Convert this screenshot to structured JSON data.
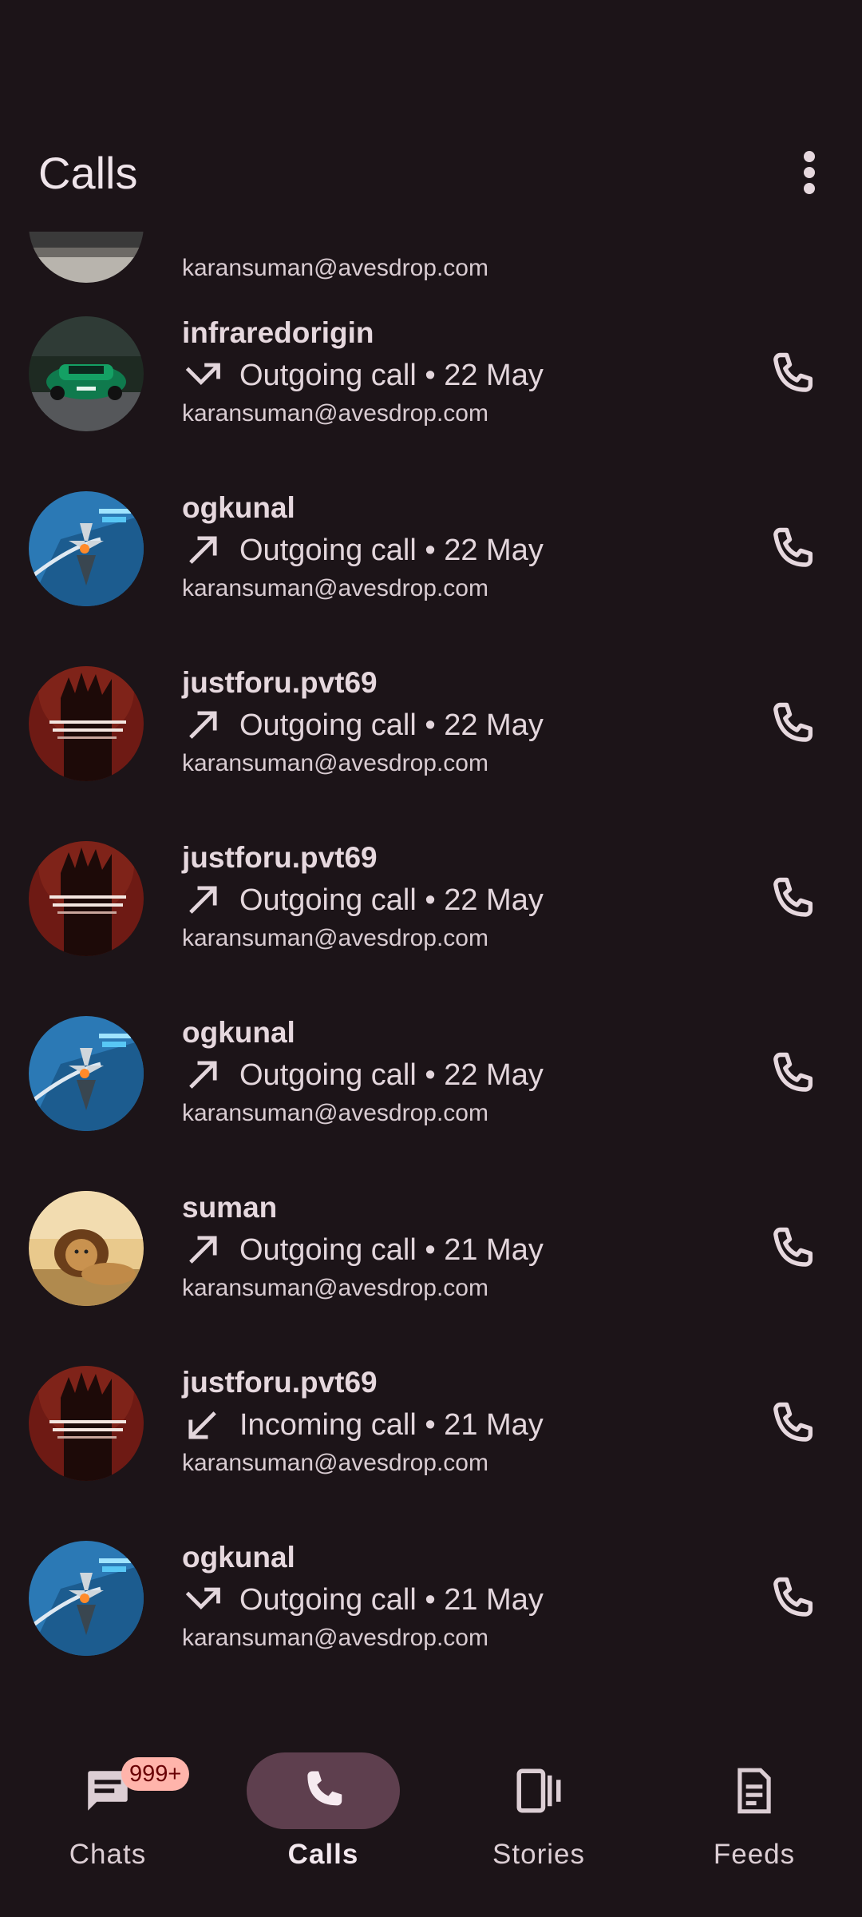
{
  "header": {
    "title": "Calls"
  },
  "partial_row": {
    "email": "karansuman@avesdrop.com"
  },
  "calls": [
    {
      "name": "infraredorigin",
      "direction": "outgoing-missed",
      "status": "Outgoing call • 22 May",
      "email": "karansuman@avesdrop.com",
      "avatar": "green-race-car"
    },
    {
      "name": "ogkunal",
      "direction": "outgoing",
      "status": "Outgoing call • 22 May",
      "email": "karansuman@avesdrop.com",
      "avatar": "blue-jet"
    },
    {
      "name": "justforu.pvt69",
      "direction": "outgoing",
      "status": "Outgoing call • 22 May",
      "email": "karansuman@avesdrop.com",
      "avatar": "red-quote"
    },
    {
      "name": "justforu.pvt69",
      "direction": "outgoing",
      "status": "Outgoing call • 22 May",
      "email": "karansuman@avesdrop.com",
      "avatar": "red-quote"
    },
    {
      "name": "ogkunal",
      "direction": "outgoing",
      "status": "Outgoing call • 22 May",
      "email": "karansuman@avesdrop.com",
      "avatar": "blue-jet"
    },
    {
      "name": "suman",
      "direction": "outgoing",
      "status": "Outgoing call • 21 May",
      "email": "karansuman@avesdrop.com",
      "avatar": "lion"
    },
    {
      "name": "justforu.pvt69",
      "direction": "incoming",
      "status": "Incoming call • 21 May",
      "email": "karansuman@avesdrop.com",
      "avatar": "red-quote"
    },
    {
      "name": "ogkunal",
      "direction": "outgoing-missed",
      "status": "Outgoing call • 21 May",
      "email": "karansuman@avesdrop.com",
      "avatar": "blue-jet"
    }
  ],
  "nav": {
    "items": [
      {
        "label": "Chats",
        "icon": "chat-icon",
        "badge": "999+"
      },
      {
        "label": "Calls",
        "icon": "phone-icon",
        "active": true
      },
      {
        "label": "Stories",
        "icon": "stories-icon"
      },
      {
        "label": "Feeds",
        "icon": "feeds-icon"
      }
    ]
  },
  "colors": {
    "background": "#1c1418",
    "active_pill": "#5e3f4e",
    "badge_bg": "#ffb4ab",
    "badge_text": "#690005"
  }
}
